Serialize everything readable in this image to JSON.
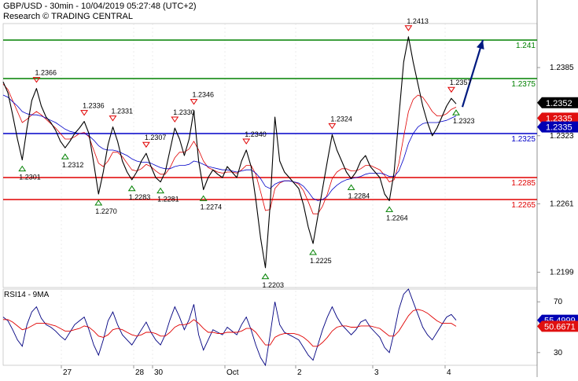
{
  "header": {
    "line1": "GBP/USD - 30min - 10/04/2019 05:27:48 (UTC+2)",
    "line2": "Research © TRADING CENTRAL"
  },
  "colors": {
    "resistance": "#008000",
    "pivot": "#0000c8",
    "support": "#e00000",
    "price": "#000000",
    "ma_fast": "#e00000",
    "ma_slow": "#0000c8",
    "arrow": "#001a80",
    "current_badge": "#000000",
    "bid_badge": "#0000b4",
    "ask_badge": "#e01010",
    "rsi": "#000080",
    "rsi_ma": "#e00000"
  },
  "chart_data": [
    {
      "type": "line",
      "panel": "price",
      "ylim": [
        1.2185,
        1.2425
      ],
      "y_ticks": [
        "1.2385",
        "1.2323",
        "1.2261",
        "1.2199"
      ],
      "x_ticks": [
        "27",
        "28",
        "30",
        "Oct",
        "2",
        "3",
        "4"
      ],
      "levels": [
        {
          "label": "1.241",
          "value": 1.241,
          "kind": "resistance"
        },
        {
          "label": "1.2375",
          "value": 1.2375,
          "kind": "resistance"
        },
        {
          "label": "1.2325",
          "value": 1.2325,
          "kind": "pivot"
        },
        {
          "label": "1.2285",
          "value": 1.2285,
          "kind": "support"
        },
        {
          "label": "1.2265",
          "value": 1.2265,
          "kind": "support"
        }
      ],
      "current_price": "1.2352",
      "ask_price": "1.2335",
      "bid_price": "1.2335",
      "projected_target": 1.241,
      "swing_points": [
        {
          "label": "1.2301",
          "value": 1.2301,
          "kind": "low"
        },
        {
          "label": "1.2366",
          "value": 1.2366,
          "kind": "high"
        },
        {
          "label": "1.2312",
          "value": 1.2312,
          "kind": "low"
        },
        {
          "label": "1.2336",
          "value": 1.2336,
          "kind": "high"
        },
        {
          "label": "1.2270",
          "value": 1.227,
          "kind": "low"
        },
        {
          "label": "1.2331",
          "value": 1.2331,
          "kind": "high"
        },
        {
          "label": "1.2283",
          "value": 1.2283,
          "kind": "low"
        },
        {
          "label": "1.2307",
          "value": 1.2307,
          "kind": "high"
        },
        {
          "label": "1.2281",
          "value": 1.2281,
          "kind": "low"
        },
        {
          "label": "1.2330",
          "value": 1.233,
          "kind": "high"
        },
        {
          "label": "1.2346",
          "value": 1.2346,
          "kind": "high"
        },
        {
          "label": "1.2274",
          "value": 1.2274,
          "kind": "low"
        },
        {
          "label": "1.2340",
          "value": 1.234,
          "kind": "high"
        },
        {
          "label": "1.2203",
          "value": 1.2203,
          "kind": "low"
        },
        {
          "label": "1.2225",
          "value": 1.2225,
          "kind": "low"
        },
        {
          "label": "1.2324",
          "value": 1.2324,
          "kind": "high"
        },
        {
          "label": "1.2284",
          "value": 1.2284,
          "kind": "low"
        },
        {
          "label": "1.2264",
          "value": 1.2264,
          "kind": "low"
        },
        {
          "label": "1.2413",
          "value": 1.2413,
          "kind": "high"
        },
        {
          "label": "1.2357",
          "value": 1.2357,
          "kind": "high"
        },
        {
          "label": "1.2323",
          "value": 1.2323,
          "kind": "low"
        }
      ],
      "series": [
        {
          "kind": "price",
          "values": [
            1.2372,
            1.2362,
            1.2342,
            1.232,
            1.2301,
            1.233,
            1.2355,
            1.2366,
            1.235,
            1.234,
            1.2335,
            1.2328,
            1.2318,
            1.2312,
            1.2318,
            1.2325,
            1.233,
            1.2336,
            1.2325,
            1.2298,
            1.227,
            1.229,
            1.2315,
            1.2331,
            1.2318,
            1.23,
            1.229,
            1.2283,
            1.229,
            1.23,
            1.2307,
            1.2295,
            1.2285,
            1.2281,
            1.229,
            1.231,
            1.233,
            1.232,
            1.2305,
            1.232,
            1.2346,
            1.23,
            1.2274,
            1.2285,
            1.2292,
            1.2288,
            1.2285,
            1.2295,
            1.229,
            1.2285,
            1.23,
            1.231,
            1.2295,
            1.2265,
            1.223,
            1.2203,
            1.226,
            1.234,
            1.23,
            1.229,
            1.2285,
            1.228,
            1.2275,
            1.226,
            1.224,
            1.2225,
            1.225,
            1.2275,
            1.23,
            1.2324,
            1.231,
            1.23,
            1.229,
            1.2284,
            1.229,
            1.23,
            1.2305,
            1.2295,
            1.229,
            1.2285,
            1.227,
            1.2264,
            1.229,
            1.234,
            1.239,
            1.2413,
            1.239,
            1.237,
            1.235,
            1.2335,
            1.2323,
            1.233,
            1.234,
            1.235,
            1.2357,
            1.2352
          ]
        },
        {
          "kind": "ma_fast",
          "values": [
            1.237,
            1.2365,
            1.2355,
            1.2345,
            1.2335,
            1.2338,
            1.2342,
            1.2345,
            1.2342,
            1.2338,
            1.2334,
            1.233,
            1.2325,
            1.232,
            1.232,
            1.2322,
            1.2325,
            1.2326,
            1.2322,
            1.231,
            1.2298,
            1.2295,
            1.23,
            1.2308,
            1.2308,
            1.2304,
            1.2298,
            1.2292,
            1.2291,
            1.2293,
            1.2297,
            1.2295,
            1.2291,
            1.2288,
            1.2288,
            1.2294,
            1.2303,
            1.2308,
            1.2308,
            1.2311,
            1.2318,
            1.231,
            1.23,
            1.2294,
            1.2292,
            1.229,
            1.2289,
            1.229,
            1.229,
            1.2289,
            1.2292,
            1.2296,
            1.2296,
            1.2288,
            1.2272,
            1.2255,
            1.2256,
            1.2275,
            1.228,
            1.2282,
            1.2282,
            1.2281,
            1.2279,
            1.2273,
            1.2263,
            1.2252,
            1.2252,
            1.2259,
            1.227,
            1.2284,
            1.229,
            1.2293,
            1.2293,
            1.2291,
            1.2291,
            1.2293,
            1.2296,
            1.2296,
            1.2294,
            1.2292,
            1.2287,
            1.2281,
            1.2283,
            1.2298,
            1.2322,
            1.2345,
            1.2356,
            1.236,
            1.2358,
            1.2352,
            1.2345,
            1.2341,
            1.2341,
            1.2343,
            1.2347,
            1.2349
          ]
        },
        {
          "kind": "ma_slow",
          "values": [
            1.236,
            1.2358,
            1.2354,
            1.235,
            1.2345,
            1.2343,
            1.2342,
            1.2342,
            1.2341,
            1.2339,
            1.2337,
            1.2335,
            1.2332,
            1.2329,
            1.2327,
            1.2326,
            1.2325,
            1.2325,
            1.2323,
            1.2319,
            1.2314,
            1.2311,
            1.231,
            1.231,
            1.2309,
            1.2307,
            1.2305,
            1.2302,
            1.23,
            1.2299,
            1.2299,
            1.2298,
            1.2296,
            1.2294,
            1.2293,
            1.2293,
            1.2295,
            1.2296,
            1.2296,
            1.2297,
            1.23,
            1.2299,
            1.2297,
            1.2295,
            1.2294,
            1.2293,
            1.2292,
            1.2292,
            1.2291,
            1.229,
            1.2291,
            1.2292,
            1.2292,
            1.2289,
            1.2284,
            1.2277,
            1.2275,
            1.2279,
            1.2281,
            1.2282,
            1.2282,
            1.2281,
            1.228,
            1.2277,
            1.2272,
            1.2266,
            1.2264,
            1.2265,
            1.2268,
            1.2274,
            1.2278,
            1.2281,
            1.2283,
            1.2284,
            1.2285,
            1.2286,
            1.2288,
            1.2289,
            1.2289,
            1.2289,
            1.2288,
            1.2286,
            1.2286,
            1.2291,
            1.2302,
            1.2316,
            1.2325,
            1.2331,
            1.2334,
            1.2335,
            1.2335,
            1.2335,
            1.2336,
            1.2337,
            1.2339,
            1.2341
          ]
        }
      ]
    },
    {
      "type": "line",
      "panel": "rsi",
      "title": "RSI14 - 9MA",
      "ylim": [
        20,
        80
      ],
      "y_ticks": [
        "70",
        "30"
      ],
      "rsi_value": "55.4999",
      "ma_value": "50.6671",
      "series": [
        {
          "kind": "rsi",
          "values": [
            58,
            55,
            48,
            40,
            35,
            52,
            62,
            66,
            57,
            52,
            50,
            47,
            43,
            40,
            46,
            52,
            55,
            58,
            48,
            36,
            28,
            40,
            55,
            62,
            52,
            44,
            40,
            36,
            42,
            48,
            54,
            46,
            40,
            36,
            44,
            56,
            66,
            58,
            48,
            56,
            68,
            44,
            32,
            40,
            48,
            46,
            44,
            50,
            47,
            44,
            52,
            58,
            48,
            36,
            26,
            20,
            44,
            70,
            52,
            46,
            44,
            42,
            40,
            34,
            28,
            24,
            36,
            48,
            58,
            66,
            58,
            52,
            48,
            44,
            48,
            54,
            56,
            50,
            46,
            42,
            34,
            30,
            46,
            64,
            76,
            80,
            70,
            60,
            50,
            44,
            40,
            46,
            52,
            58,
            60,
            55.5
          ]
        },
        {
          "kind": "rsi_ma",
          "values": [
            56,
            56,
            54,
            51,
            48,
            49,
            51,
            53,
            53,
            53,
            52,
            51,
            49,
            47,
            47,
            48,
            49,
            51,
            50,
            47,
            43,
            42,
            44,
            48,
            49,
            48,
            46,
            44,
            43,
            44,
            46,
            46,
            45,
            43,
            43,
            46,
            50,
            52,
            52,
            53,
            56,
            53,
            49,
            46,
            46,
            45,
            45,
            46,
            46,
            46,
            47,
            49,
            49,
            46,
            41,
            36,
            36,
            42,
            44,
            45,
            45,
            45,
            44,
            42,
            39,
            35,
            35,
            38,
            42,
            47,
            50,
            51,
            51,
            50,
            50,
            51,
            51,
            51,
            50,
            49,
            46,
            43,
            43,
            47,
            53,
            59,
            63,
            64,
            63,
            61,
            58,
            55,
            53,
            53,
            53,
            50.7
          ]
        }
      ]
    }
  ]
}
